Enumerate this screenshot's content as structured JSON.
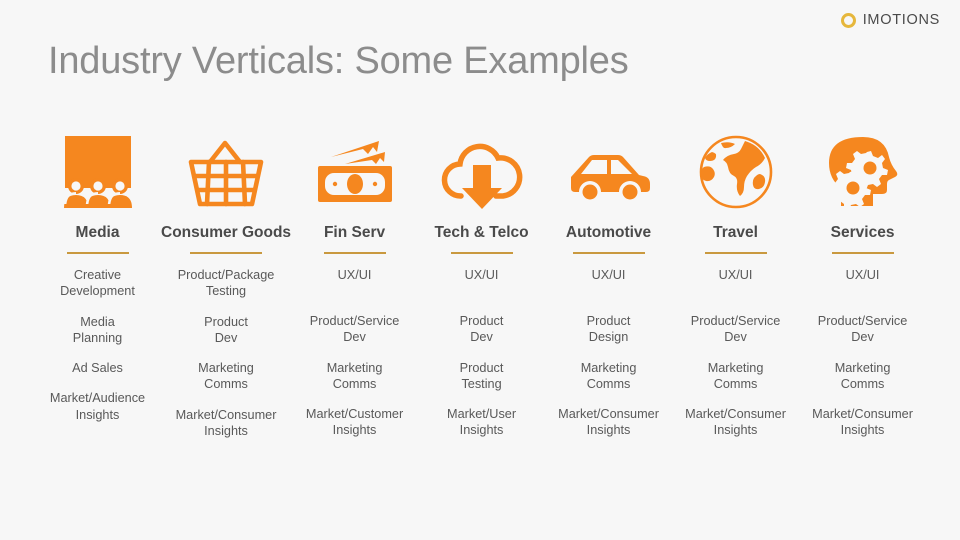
{
  "brand": {
    "mark": "ring-logo-icon",
    "wordmark": "IMOTIONS",
    "mark_color": "#e6b73c",
    "wordmark_color": "#4a4a4a"
  },
  "page": {
    "title": "Industry Verticals: Some Examples",
    "background_color": "#f7f7f7",
    "title_color": "#8c8c8c",
    "accent_orange": "#f5871f",
    "rule_color": "#c9993f"
  },
  "columns": [
    {
      "title": "Media",
      "icon": "billboard-audience-icon",
      "items": [
        "Creative\nDevelopment",
        "Media\nPlanning",
        "Ad Sales",
        "Market/Audience\nInsights"
      ]
    },
    {
      "title": "Consumer Goods",
      "icon": "shopping-basket-icon",
      "items": [
        "Product/Package\nTesting",
        "Product\nDev",
        "Marketing\nComms",
        "Market/Consumer\nInsights"
      ]
    },
    {
      "title": "Fin Serv",
      "icon": "banknotes-icon",
      "items": [
        "UX/UI",
        "Product/Service\nDev",
        "Marketing\nComms",
        "Market/Customer\nInsights"
      ]
    },
    {
      "title": "Tech & Telco",
      "icon": "cloud-download-icon",
      "items": [
        "UX/UI",
        "Product\nDev",
        "Product\nTesting",
        "Market/User\nInsights"
      ]
    },
    {
      "title": "Automotive",
      "icon": "car-icon",
      "items": [
        "UX/UI",
        "Product\nDesign",
        "Marketing\nComms",
        "Market/Consumer\nInsights"
      ]
    },
    {
      "title": "Travel",
      "icon": "globe-icon",
      "items": [
        "UX/UI",
        "Product/Service\nDev",
        "Marketing\nComms",
        "Market/Consumer\nInsights"
      ]
    },
    {
      "title": "Services",
      "icon": "head-gears-icon",
      "items": [
        "UX/UI",
        "Product/Service\nDev",
        "Marketing\nComms",
        "Market/Consumer\nInsights"
      ]
    }
  ]
}
